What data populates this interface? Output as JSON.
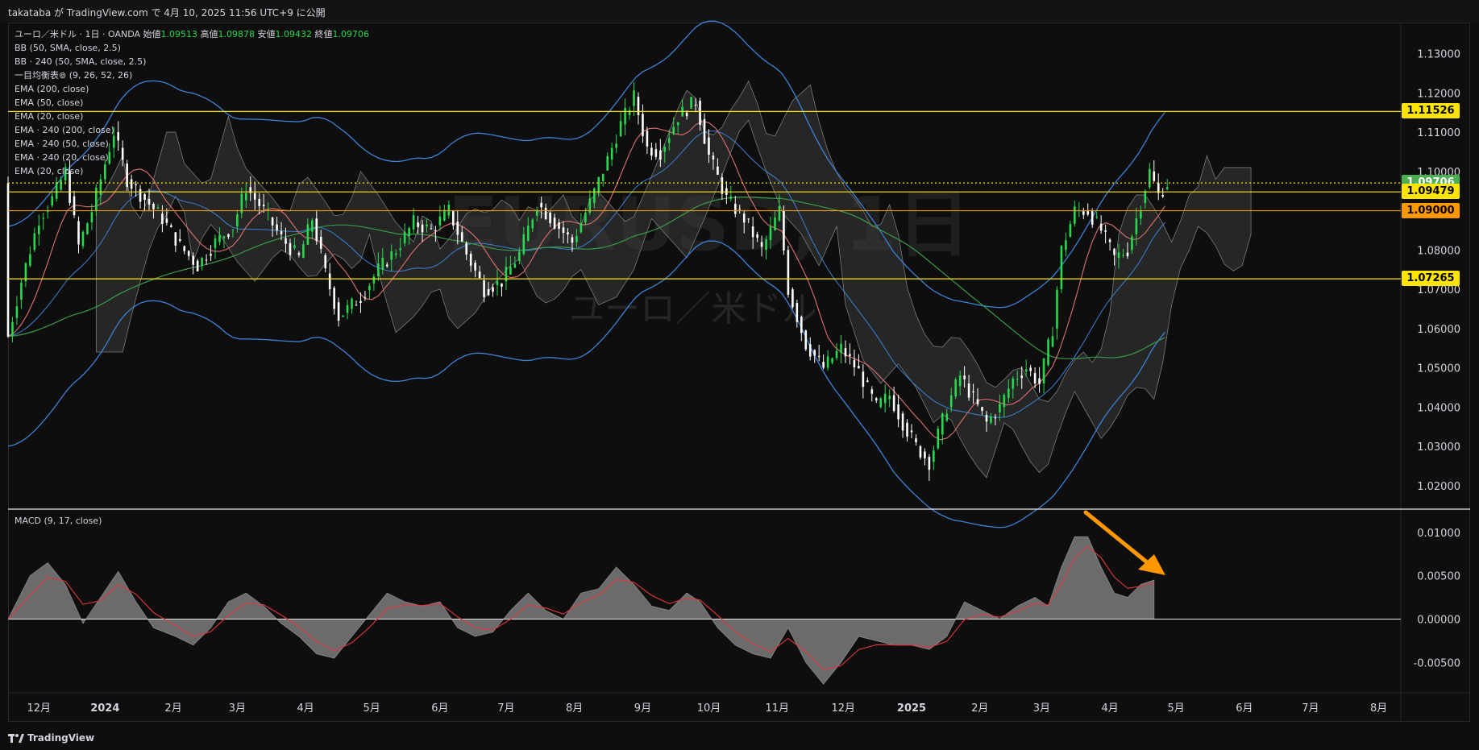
{
  "header": {
    "publish_text": "takataba が TradingView.com で 4月 10, 2025 11:56 UTC+9 に公開"
  },
  "legend": {
    "symbol": "ユーロ／米ドル · 1日 · OANDA",
    "open_label": "始値",
    "open": "1.09513",
    "high_label": "高値",
    "high": "1.09878",
    "low_label": "安値",
    "low": "1.09432",
    "close_label": "終値",
    "close": "1.09706",
    "indicators": [
      "BB (50, SMA, close, 2.5)",
      "BB · 240 (50, SMA, close, 2.5)",
      "一目均衡表⊚ (9, 26, 52, 26)",
      "EMA (200, close)",
      "EMA (50, close)",
      "EMA (20, close)",
      "EMA · 240 (200, close)",
      "EMA · 240 (50, close)",
      "EMA · 240 (20, close)",
      "EMA (20, close)"
    ]
  },
  "watermark": {
    "ticker": "EURUSD, 1日",
    "name": "ユーロ／米ドル"
  },
  "macd_label": "MACD (9, 17, close)",
  "price_badges": [
    {
      "value": "1.11526",
      "color": "#ffe500"
    },
    {
      "value": "1.09706",
      "color": "#4caf50"
    },
    {
      "value": "1.09479",
      "color": "#ffe500"
    },
    {
      "value": "1.09000",
      "color": "#ff9800"
    },
    {
      "value": "1.07265",
      "color": "#ffe500"
    }
  ],
  "footer": {
    "brand": "TradingView"
  },
  "chart_data": {
    "type": "line",
    "title": "EURUSD, 1日",
    "price_axis": {
      "ticks": [
        "1.13000",
        "1.12000",
        "1.11000",
        "1.10000",
        "1.09000",
        "1.08000",
        "1.07000",
        "1.06000",
        "1.05000",
        "1.04000",
        "1.03000",
        "1.02000"
      ],
      "ylim": [
        1.014,
        1.1375
      ]
    },
    "macd_axis": {
      "ticks": [
        "0.01000",
        "0.00500",
        "0.00000",
        "-0.00500"
      ],
      "ylim": [
        -0.0085,
        0.0125
      ]
    },
    "time_axis": {
      "labels": [
        "12月",
        "2024",
        "2月",
        "3月",
        "4月",
        "5月",
        "6月",
        "7月",
        "8月",
        "9月",
        "10月",
        "11月",
        "12月",
        "2025",
        "2月",
        "3月",
        "4月",
        "5月",
        "6月",
        "7月",
        "8月"
      ],
      "bold": [
        "2024",
        "2025"
      ],
      "day_index": [
        0,
        30,
        61,
        90,
        121,
        151,
        182,
        212,
        243,
        274,
        304,
        335,
        365,
        396,
        427,
        455,
        486,
        516,
        547,
        577,
        608
      ],
      "total_days": 618,
      "start_offset_days": -14
    },
    "horizontal_levels": [
      {
        "value": 1.11526,
        "color": "#ffe500",
        "style": "solid"
      },
      {
        "value": 1.09706,
        "color": "#ffe500",
        "style": "dotted"
      },
      {
        "value": 1.09479,
        "color": "#ffe500",
        "style": "solid"
      },
      {
        "value": 1.09,
        "color": "#ff9800",
        "style": "solid"
      },
      {
        "value": 1.07265,
        "color": "#ffe500",
        "style": "solid"
      }
    ],
    "price_series": [
      {
        "d": -14,
        "v": 1.058
      },
      {
        "d": -8,
        "v": 1.072
      },
      {
        "d": 0,
        "v": 1.088
      },
      {
        "d": 6,
        "v": 1.093
      },
      {
        "d": 12,
        "v": 1.1
      },
      {
        "d": 18,
        "v": 1.081
      },
      {
        "d": 24,
        "v": 1.09
      },
      {
        "d": 30,
        "v": 1.102
      },
      {
        "d": 34,
        "v": 1.11
      },
      {
        "d": 40,
        "v": 1.098
      },
      {
        "d": 48,
        "v": 1.093
      },
      {
        "d": 56,
        "v": 1.088
      },
      {
        "d": 64,
        "v": 1.081
      },
      {
        "d": 72,
        "v": 1.076
      },
      {
        "d": 80,
        "v": 1.082
      },
      {
        "d": 88,
        "v": 1.086
      },
      {
        "d": 94,
        "v": 1.096
      },
      {
        "d": 102,
        "v": 1.09
      },
      {
        "d": 110,
        "v": 1.083
      },
      {
        "d": 118,
        "v": 1.078
      },
      {
        "d": 124,
        "v": 1.088
      },
      {
        "d": 130,
        "v": 1.074
      },
      {
        "d": 136,
        "v": 1.063
      },
      {
        "d": 146,
        "v": 1.068
      },
      {
        "d": 154,
        "v": 1.075
      },
      {
        "d": 162,
        "v": 1.08
      },
      {
        "d": 170,
        "v": 1.087
      },
      {
        "d": 178,
        "v": 1.085
      },
      {
        "d": 186,
        "v": 1.09
      },
      {
        "d": 194,
        "v": 1.079
      },
      {
        "d": 202,
        "v": 1.07
      },
      {
        "d": 210,
        "v": 1.072
      },
      {
        "d": 218,
        "v": 1.079
      },
      {
        "d": 226,
        "v": 1.092
      },
      {
        "d": 234,
        "v": 1.087
      },
      {
        "d": 242,
        "v": 1.082
      },
      {
        "d": 250,
        "v": 1.092
      },
      {
        "d": 258,
        "v": 1.103
      },
      {
        "d": 264,
        "v": 1.112
      },
      {
        "d": 270,
        "v": 1.119
      },
      {
        "d": 276,
        "v": 1.106
      },
      {
        "d": 282,
        "v": 1.105
      },
      {
        "d": 290,
        "v": 1.114
      },
      {
        "d": 298,
        "v": 1.118
      },
      {
        "d": 304,
        "v": 1.104
      },
      {
        "d": 312,
        "v": 1.093
      },
      {
        "d": 320,
        "v": 1.088
      },
      {
        "d": 328,
        "v": 1.08
      },
      {
        "d": 336,
        "v": 1.09
      },
      {
        "d": 340,
        "v": 1.07
      },
      {
        "d": 348,
        "v": 1.056
      },
      {
        "d": 356,
        "v": 1.05
      },
      {
        "d": 364,
        "v": 1.055
      },
      {
        "d": 372,
        "v": 1.049
      },
      {
        "d": 380,
        "v": 1.04
      },
      {
        "d": 386,
        "v": 1.043
      },
      {
        "d": 392,
        "v": 1.036
      },
      {
        "d": 398,
        "v": 1.03
      },
      {
        "d": 404,
        "v": 1.026
      },
      {
        "d": 412,
        "v": 1.04
      },
      {
        "d": 418,
        "v": 1.048
      },
      {
        "d": 424,
        "v": 1.042
      },
      {
        "d": 430,
        "v": 1.036
      },
      {
        "d": 436,
        "v": 1.04
      },
      {
        "d": 442,
        "v": 1.047
      },
      {
        "d": 448,
        "v": 1.05
      },
      {
        "d": 454,
        "v": 1.046
      },
      {
        "d": 460,
        "v": 1.06
      },
      {
        "d": 464,
        "v": 1.08
      },
      {
        "d": 470,
        "v": 1.09
      },
      {
        "d": 476,
        "v": 1.09
      },
      {
        "d": 482,
        "v": 1.085
      },
      {
        "d": 488,
        "v": 1.078
      },
      {
        "d": 494,
        "v": 1.08
      },
      {
        "d": 500,
        "v": 1.092
      },
      {
        "d": 504,
        "v": 1.1
      },
      {
        "d": 508,
        "v": 1.094
      },
      {
        "d": 512,
        "v": 1.097
      }
    ],
    "macd_series": [
      {
        "d": -14,
        "v": 0.0
      },
      {
        "d": -4,
        "v": 0.005
      },
      {
        "d": 4,
        "v": 0.0065
      },
      {
        "d": 12,
        "v": 0.004
      },
      {
        "d": 20,
        "v": -0.0005
      },
      {
        "d": 28,
        "v": 0.0025
      },
      {
        "d": 36,
        "v": 0.0055
      },
      {
        "d": 44,
        "v": 0.002
      },
      {
        "d": 52,
        "v": -0.001
      },
      {
        "d": 62,
        "v": -0.002
      },
      {
        "d": 70,
        "v": -0.003
      },
      {
        "d": 78,
        "v": -0.001
      },
      {
        "d": 86,
        "v": 0.002
      },
      {
        "d": 94,
        "v": 0.003
      },
      {
        "d": 102,
        "v": 0.0015
      },
      {
        "d": 110,
        "v": -0.0005
      },
      {
        "d": 118,
        "v": -0.002
      },
      {
        "d": 126,
        "v": -0.004
      },
      {
        "d": 134,
        "v": -0.0045
      },
      {
        "d": 142,
        "v": -0.002
      },
      {
        "d": 150,
        "v": 0.0005
      },
      {
        "d": 158,
        "v": 0.003
      },
      {
        "d": 166,
        "v": 0.002
      },
      {
        "d": 174,
        "v": 0.0015
      },
      {
        "d": 182,
        "v": 0.002
      },
      {
        "d": 190,
        "v": -0.001
      },
      {
        "d": 198,
        "v": -0.002
      },
      {
        "d": 206,
        "v": -0.0015
      },
      {
        "d": 214,
        "v": 0.001
      },
      {
        "d": 222,
        "v": 0.003
      },
      {
        "d": 230,
        "v": 0.001
      },
      {
        "d": 238,
        "v": 0.0
      },
      {
        "d": 246,
        "v": 0.003
      },
      {
        "d": 254,
        "v": 0.0035
      },
      {
        "d": 262,
        "v": 0.006
      },
      {
        "d": 270,
        "v": 0.004
      },
      {
        "d": 278,
        "v": 0.0015
      },
      {
        "d": 286,
        "v": 0.001
      },
      {
        "d": 294,
        "v": 0.003
      },
      {
        "d": 300,
        "v": 0.002
      },
      {
        "d": 308,
        "v": -0.001
      },
      {
        "d": 316,
        "v": -0.003
      },
      {
        "d": 324,
        "v": -0.004
      },
      {
        "d": 332,
        "v": -0.0045
      },
      {
        "d": 340,
        "v": -0.001
      },
      {
        "d": 348,
        "v": -0.005
      },
      {
        "d": 356,
        "v": -0.0075
      },
      {
        "d": 364,
        "v": -0.005
      },
      {
        "d": 372,
        "v": -0.002
      },
      {
        "d": 380,
        "v": -0.0025
      },
      {
        "d": 388,
        "v": -0.003
      },
      {
        "d": 396,
        "v": -0.003
      },
      {
        "d": 404,
        "v": -0.0035
      },
      {
        "d": 412,
        "v": -0.002
      },
      {
        "d": 420,
        "v": 0.002
      },
      {
        "d": 428,
        "v": 0.001
      },
      {
        "d": 436,
        "v": 0.0
      },
      {
        "d": 444,
        "v": 0.0015
      },
      {
        "d": 452,
        "v": 0.0025
      },
      {
        "d": 458,
        "v": 0.0015
      },
      {
        "d": 464,
        "v": 0.006
      },
      {
        "d": 470,
        "v": 0.0095
      },
      {
        "d": 476,
        "v": 0.0095
      },
      {
        "d": 482,
        "v": 0.006
      },
      {
        "d": 488,
        "v": 0.003
      },
      {
        "d": 494,
        "v": 0.0025
      },
      {
        "d": 500,
        "v": 0.004
      },
      {
        "d": 506,
        "v": 0.0045
      }
    ],
    "colors": {
      "bull": "#26d94d",
      "bear": "#ffffff",
      "macd_fill": "#6b6b6b",
      "signal": "#e0373f",
      "bb": "#3c82d7",
      "ema200": "#3a9a4a",
      "ema20": "#e07070",
      "cloud": "#3a3a3a",
      "arrow": "#ff9800"
    }
  }
}
